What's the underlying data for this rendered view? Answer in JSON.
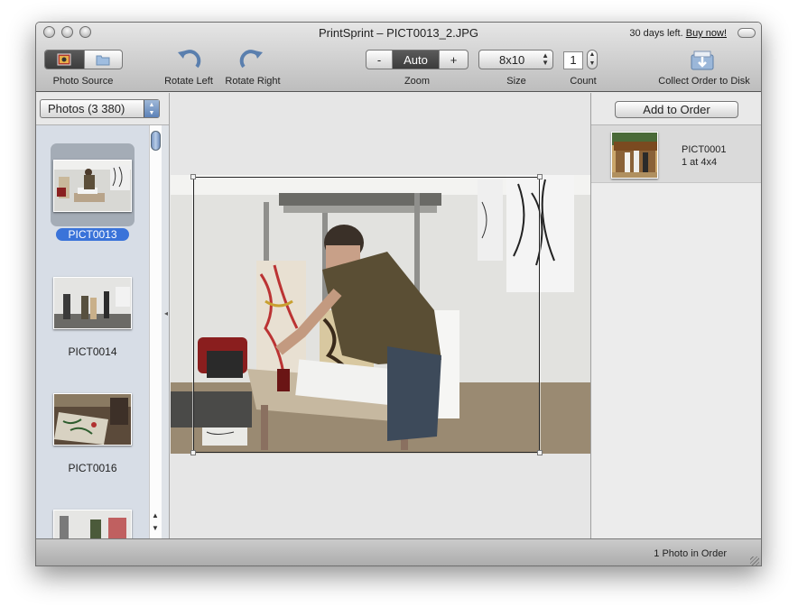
{
  "window": {
    "title": "PrintSprint – PICT0013_2.JPG",
    "trial_text": "30 days left.",
    "buy_link": "Buy now!"
  },
  "toolbar": {
    "photo_source_label": "Photo Source",
    "rotate_left_label": "Rotate Left",
    "rotate_right_label": "Rotate Right",
    "zoom": {
      "minus": "-",
      "value": "Auto",
      "plus": "+",
      "label": "Zoom"
    },
    "size": {
      "value": "8x10",
      "label": "Size"
    },
    "count": {
      "value": "1",
      "label": "Count"
    },
    "collect_label": "Collect Order to Disk",
    "icons": [
      "iphoto-icon",
      "folder-icon",
      "rotate-left-icon",
      "rotate-right-icon",
      "disk-export-icon"
    ]
  },
  "sidebar": {
    "album_popup": "Photos (3 380)",
    "thumbnails": [
      {
        "label": "PICT0013",
        "selected": true
      },
      {
        "label": "PICT0014",
        "selected": false
      },
      {
        "label": "PICT0016",
        "selected": false
      },
      {
        "label": "",
        "selected": false
      }
    ]
  },
  "order": {
    "add_button": "Add to Order",
    "items": [
      {
        "name": "PICT0001",
        "qty": "1 at 4x4"
      }
    ]
  },
  "status": {
    "text": "1 Photo in Order"
  },
  "colors": {
    "selection": "#3a73d9",
    "sidebar_bg": "#d7dde6"
  }
}
